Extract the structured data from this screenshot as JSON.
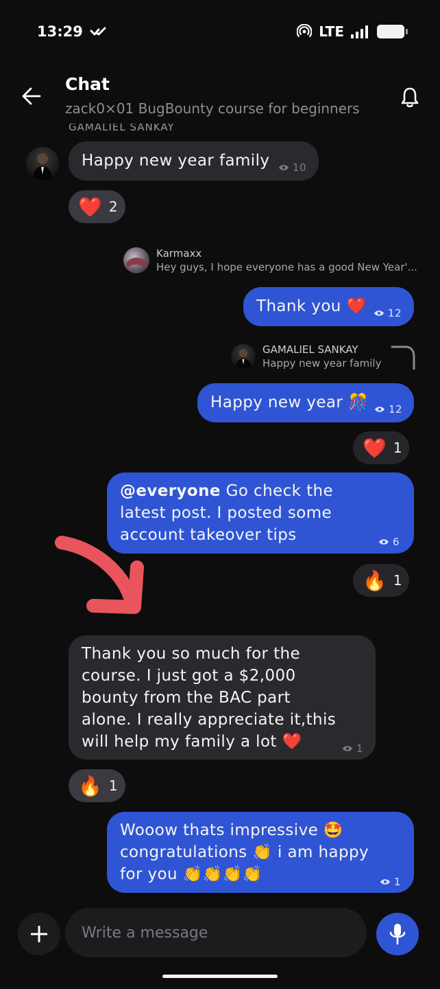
{
  "status": {
    "time": "13:29",
    "network": "LTE",
    "icons": [
      "vpn-icon",
      "hotspot-icon",
      "signal-icon",
      "battery-icon"
    ]
  },
  "header": {
    "title": "Chat",
    "subtitle": "zack0×01 BugBounty course for beginners",
    "icons": [
      "back-arrow-icon",
      "bell-icon"
    ]
  },
  "chat": {
    "cut_name": "GAMALIEL SANKAY",
    "messages": [
      {
        "id": "m1",
        "direction": "in",
        "text": "Happy new year family",
        "views": "10",
        "reaction": {
          "emoji": "❤️",
          "count": "2"
        }
      },
      {
        "id": "m2",
        "direction": "out",
        "reply_to": {
          "name": "Karmaxx",
          "text": "Hey guys, I hope everyone has a good New Year'..."
        },
        "text": "Thank you ❤️",
        "views": "12"
      },
      {
        "id": "m3",
        "direction": "out",
        "reply_to": {
          "name": "GAMALIEL SANKAY",
          "text": "Happy new year family"
        },
        "text": "Happy new year 🎊",
        "views": "12",
        "reaction": {
          "emoji": "❤️",
          "count": "1"
        }
      },
      {
        "id": "m4",
        "direction": "out",
        "mention": "@everyone",
        "text": " Go check the latest post. I posted some account takeover tips",
        "views": "6",
        "reaction": {
          "emoji": "🔥",
          "count": "1"
        }
      },
      {
        "id": "m5",
        "direction": "in",
        "text": "Thank you so much for the course. I just got a $2,000 bounty from the BAC part alone. I really appreciate it,this will help my family a lot ❤️",
        "views": "1",
        "reaction": {
          "emoji": "🔥",
          "count": "1"
        }
      },
      {
        "id": "m6",
        "direction": "out",
        "text": "Wooow thats impressive 🤩 congratulations 👏 i am happy for you 👏👏👏👏",
        "views": "1"
      }
    ]
  },
  "composer": {
    "placeholder": "Write a message",
    "icons": [
      "plus-icon",
      "mic-icon"
    ]
  },
  "colors": {
    "background": "#0d0d0d",
    "incoming_bubble": "#2a2a2e",
    "outgoing_bubble": "#2f55d4",
    "annotation_arrow": "#e8555c"
  }
}
